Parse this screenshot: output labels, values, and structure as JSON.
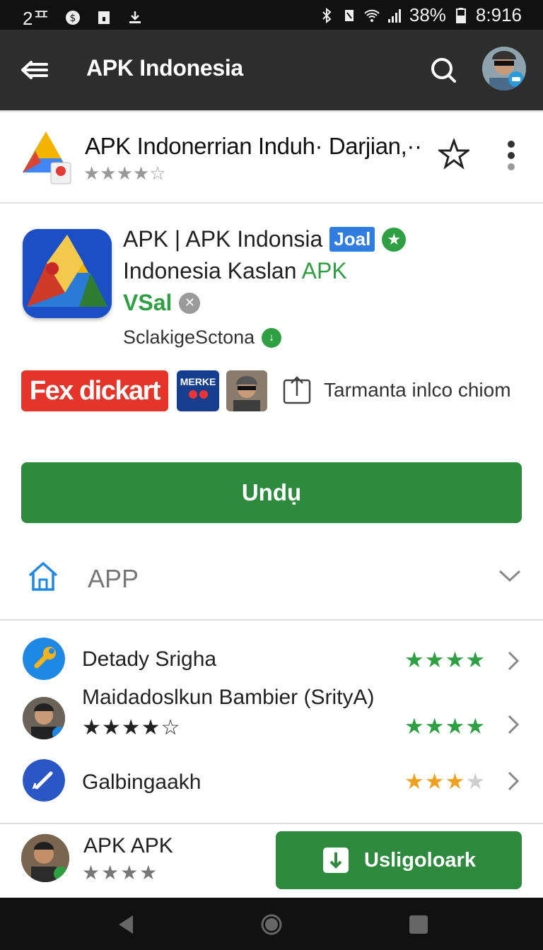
{
  "status_bar": {
    "left_text": "2ᄑ",
    "battery_pct": "38%",
    "time": "8:916"
  },
  "app_bar": {
    "title": "APK Indonesia"
  },
  "header": {
    "app_name": "APK Indonerrian Induh· Darjian,··",
    "rating_stars": "★★★★☆"
  },
  "detail": {
    "line1": "APK | APK Indonsia",
    "badge": "Joal",
    "line2_prefix": "Indonesia Kaslan ",
    "line2_green": "APK",
    "line3": "VSal",
    "developer": "SclakigeSctona",
    "promo_label": "Fex dickart",
    "merk_label": "MERKE",
    "share_text": "Tarmanta inlco chiom"
  },
  "download_button": "Undụ",
  "app_section": {
    "label": "APP"
  },
  "list": [
    {
      "title": "Detady Srigha",
      "stars": "★★★★",
      "star_rating": 4
    },
    {
      "title": "Maidadoslkun Bambier (SrityA)",
      "sub_stars": "★★★★☆",
      "stars": "★★★★",
      "star_rating": 4
    },
    {
      "title": "Galbingaakh",
      "stars_filled": "★★★",
      "stars_empty": "★",
      "star_rating": 3
    }
  ],
  "bottom": {
    "title": "APK APK",
    "stars": "★★★★",
    "install_label": "Usligoloark"
  },
  "colors": {
    "brand_green": "#2e8b3e",
    "accent_green": "#2ea043",
    "promo_red": "#e5342a",
    "badge_blue": "#2f7de1",
    "app_bar": "#2d2d2d"
  }
}
